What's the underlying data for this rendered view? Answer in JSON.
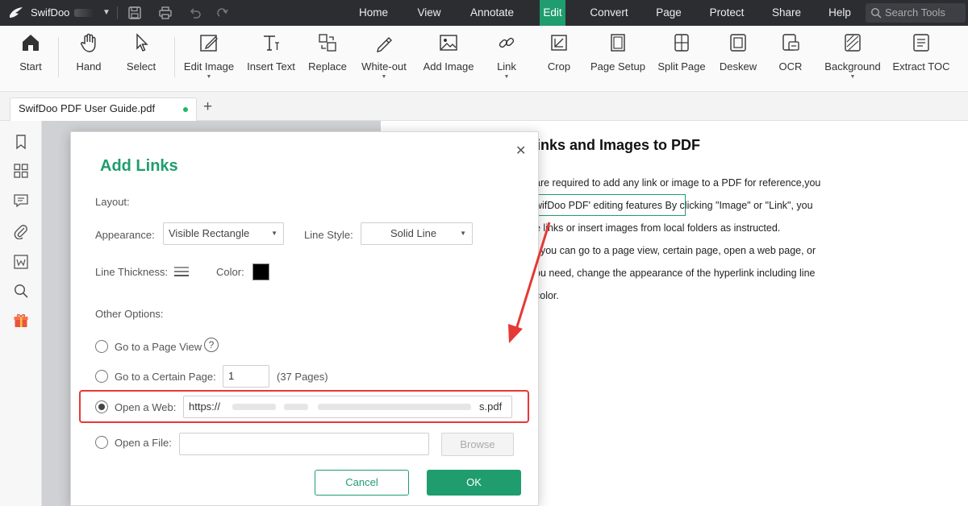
{
  "app": {
    "name": "SwifDoo"
  },
  "menu": [
    "Home",
    "View",
    "Annotate",
    "Edit",
    "Convert",
    "Page",
    "Protect",
    "Share",
    "Help"
  ],
  "active_menu": "Edit",
  "search_tools": "Search Tools",
  "ribbon": {
    "start": "Start",
    "hand": "Hand",
    "select": "Select",
    "edit_image": "Edit Image",
    "insert_text": "Insert Text",
    "replace": "Replace",
    "white_out": "White-out",
    "add_image": "Add Image",
    "link": "Link",
    "crop": "Crop",
    "page_setup": "Page Setup",
    "split_page": "Split Page",
    "deskew": "Deskew",
    "ocr": "OCR",
    "background": "Background",
    "extract_toc": "Extract TOC"
  },
  "tab": {
    "label": "SwifDoo PDF User Guide.pdf"
  },
  "doc": {
    "heading": "inks and Images to PDF",
    "lines": [
      "are required to add any link or image to a PDF for reference,you",
      "wifDoo PDF' editing features  By clicking \"Image\" or \"Link\", you",
      "e links or insert images from local folders as instructed.",
      ", you can go to a page view, certain page, open a web page, or",
      "ou need, change the appearance of the hyperlink including line",
      "color."
    ]
  },
  "dialog": {
    "title": "Add Links",
    "layout_label": "Layout:",
    "appearance_label": "Appearance:",
    "appearance_value": "Visible Rectangle",
    "line_style_label": "Line Style:",
    "line_style_value": "Solid Line",
    "line_thickness_label": "Line Thickness:",
    "color_label": "Color:",
    "other_options_label": "Other Options:",
    "opt_page_view": "Go to a Page View",
    "help_glyph": "?",
    "opt_certain_page": "Go to a Certain Page:",
    "page_value": "1",
    "pages_note": "(37 Pages)",
    "opt_web": "Open a Web:",
    "web_prefix": "https://",
    "web_suffix": "s.pdf",
    "opt_file": "Open a File:",
    "browse": "Browse",
    "cancel": "Cancel",
    "ok": "OK"
  },
  "colors": {
    "accent": "#1f9d6f",
    "highlight_red": "#e53935",
    "titlebar": "#2b2d31"
  }
}
